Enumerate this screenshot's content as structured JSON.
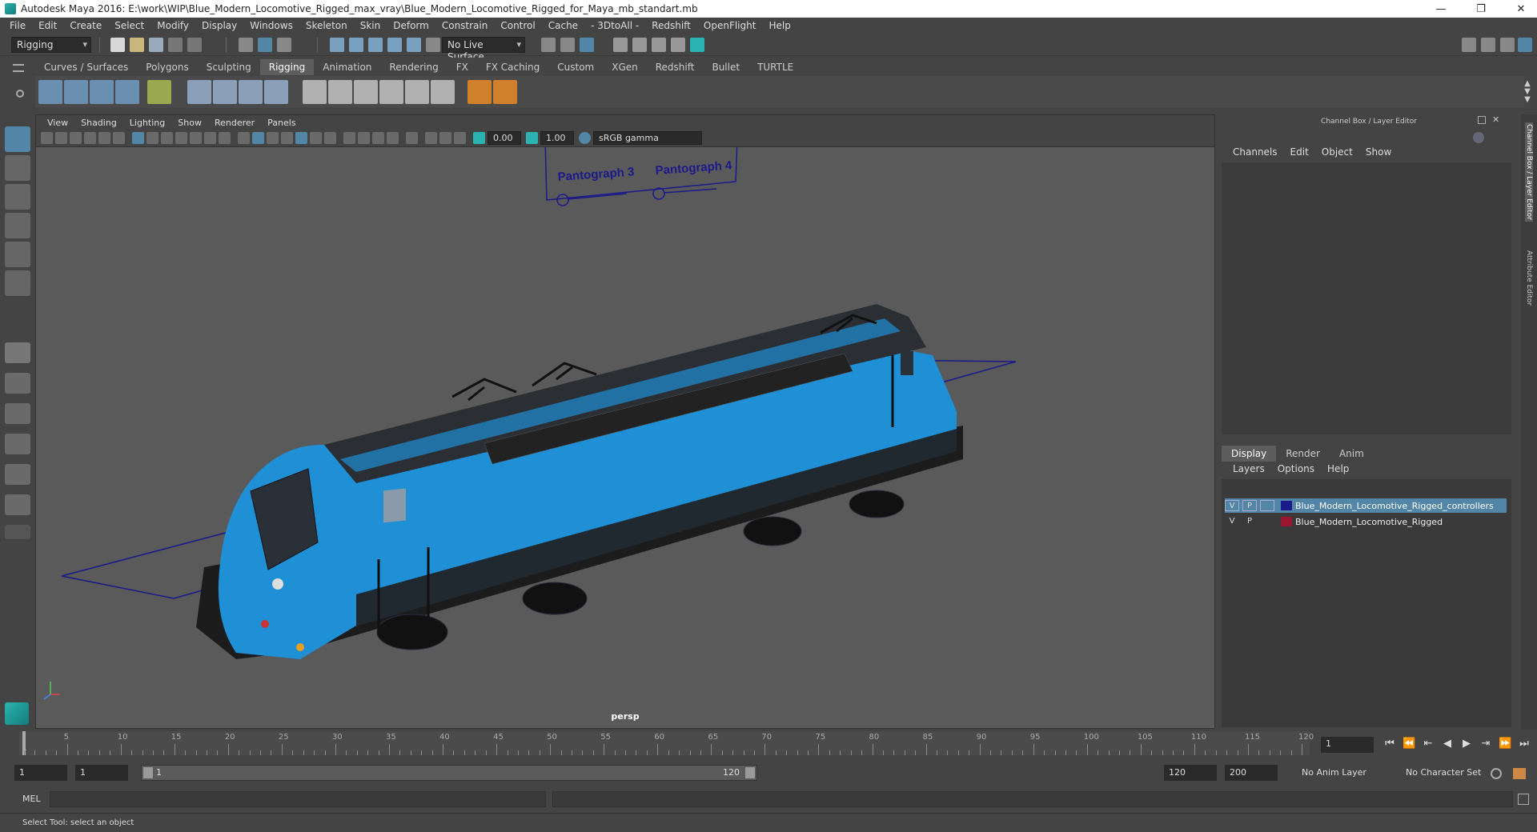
{
  "window": {
    "title": "Autodesk Maya 2016: E:\\work\\WIP\\Blue_Modern_Locomotive_Rigged_max_vray\\Blue_Modern_Locomotive_Rigged_for_Maya_mb_standart.mb",
    "minimize": "—",
    "restore": "❐",
    "close": "✕"
  },
  "menubar": [
    "File",
    "Edit",
    "Create",
    "Select",
    "Modify",
    "Display",
    "Windows",
    "Skeleton",
    "Skin",
    "Deform",
    "Constrain",
    "Control",
    "Cache",
    "- 3DtoAll -",
    "Redshift",
    "OpenFlight",
    "Help"
  ],
  "statusline": {
    "menuset": "Rigging",
    "live_surface": "No Live Surface"
  },
  "shelf": {
    "tabs": [
      "Curves / Surfaces",
      "Polygons",
      "Sculpting",
      "Rigging",
      "Animation",
      "Rendering",
      "FX",
      "FX Caching",
      "Custom",
      "XGen",
      "Redshift",
      "Bullet",
      "TURTLE"
    ],
    "active": "Rigging"
  },
  "viewport": {
    "menu": [
      "View",
      "Shading",
      "Lighting",
      "Show",
      "Renderer",
      "Panels"
    ],
    "exposure": "0.00",
    "gamma": "1.00",
    "colorspace": "sRGB gamma",
    "camera_label": "persp",
    "sign_labels": [
      "Pantograph 3",
      "Pantograph 4"
    ]
  },
  "channelbox": {
    "header": "Channel Box / Layer Editor",
    "menu": [
      "Channels",
      "Edit",
      "Object",
      "Show"
    ]
  },
  "layereditor": {
    "tabs": [
      "Display",
      "Render",
      "Anim"
    ],
    "active_tab": "Display",
    "menu": [
      "Layers",
      "Options",
      "Help"
    ],
    "layers": [
      {
        "v": "V",
        "p": "P",
        "name": "Blue_Modern_Locomotive_Rigged_controllers",
        "color": "#1a1a8a",
        "selected": true
      },
      {
        "v": "V",
        "p": "P",
        "name": "Blue_Modern_Locomotive_Rigged",
        "color": "#9a1530",
        "selected": false
      }
    ]
  },
  "sidetabs": {
    "channel_box": "Channel Box / Layer Editor",
    "attribute_editor": "Attribute Editor"
  },
  "timeline": {
    "labels": [
      "5",
      "10",
      "15",
      "20",
      "25",
      "30",
      "35",
      "40",
      "45",
      "50",
      "55",
      "60",
      "65",
      "70",
      "75",
      "80",
      "85",
      "90",
      "95",
      "100",
      "105",
      "110",
      "115",
      "120"
    ],
    "current_marker": "1",
    "current_frame": "1"
  },
  "range": {
    "start": "1",
    "playback_start": "1",
    "slider_start": "1",
    "slider_end": "120",
    "playback_end": "120",
    "end": "200",
    "anim_layer": "No Anim Layer",
    "character_set": "No Character Set"
  },
  "commandline": {
    "label": "MEL"
  },
  "helpline": {
    "text": "Select Tool: select an object"
  },
  "colors": {
    "accent": "#5285a6",
    "loco_blue": "#1f8fd6"
  }
}
